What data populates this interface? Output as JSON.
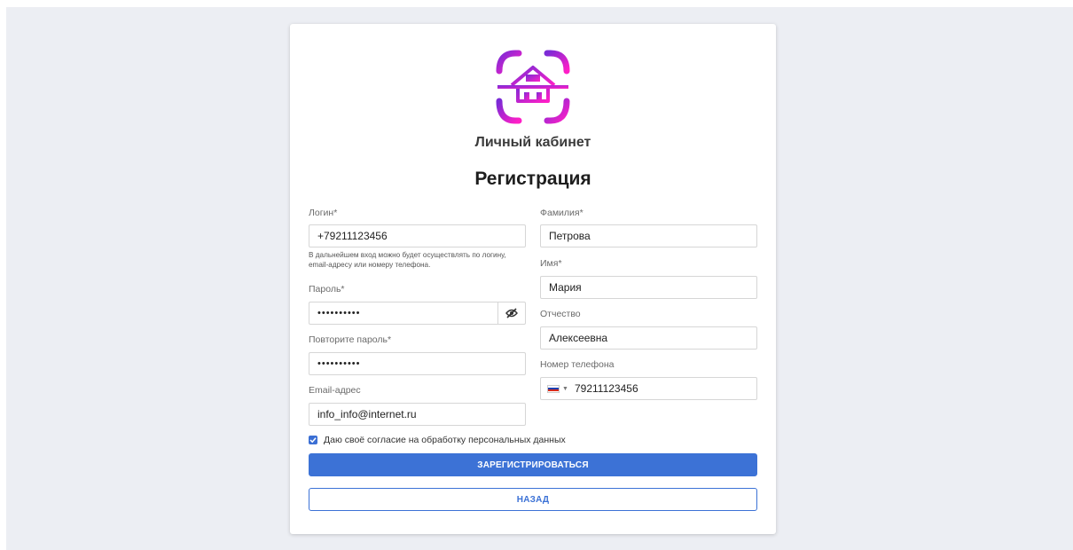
{
  "brand": {
    "title": "Личный кабинет"
  },
  "form": {
    "heading": "Регистрация",
    "login": {
      "label": "Логин*",
      "value": "+79211123456",
      "hint": "В дальнейшем вход можно будет осуществлять по логину, email-адресу или номеру телефона."
    },
    "password": {
      "label": "Пароль*",
      "value": "••••••••••"
    },
    "password_repeat": {
      "label": "Повторите пароль*",
      "value": "••••••••••"
    },
    "email": {
      "label": "Email-адрес",
      "value": "info_info@internet.ru"
    },
    "last_name": {
      "label": "Фамилия*",
      "value": "Петрова"
    },
    "first_name": {
      "label": "Имя*",
      "value": "Мария"
    },
    "middle_name": {
      "label": "Отчество",
      "value": "Алексеевна"
    },
    "phone": {
      "label": "Номер телефона",
      "value": "79211123456",
      "country_flag": "russia-flag"
    },
    "consent": {
      "label": "Даю своё согласие на обработку персональных данных",
      "checked": true
    },
    "submit_label": "ЗАРЕГИСТРИРОВАТЬСЯ",
    "back_label": "НАЗАД"
  },
  "colors": {
    "background": "#eceef3",
    "primary": "#3c72d6",
    "logo_gradient_start": "#7b2bd6",
    "logo_gradient_end": "#ff1fc7"
  },
  "icons": {
    "logo": "house-scan-icon",
    "password_toggle": "eye-slash-icon",
    "checkbox": "check-icon",
    "phone_country_caret": "caret-down-icon"
  }
}
